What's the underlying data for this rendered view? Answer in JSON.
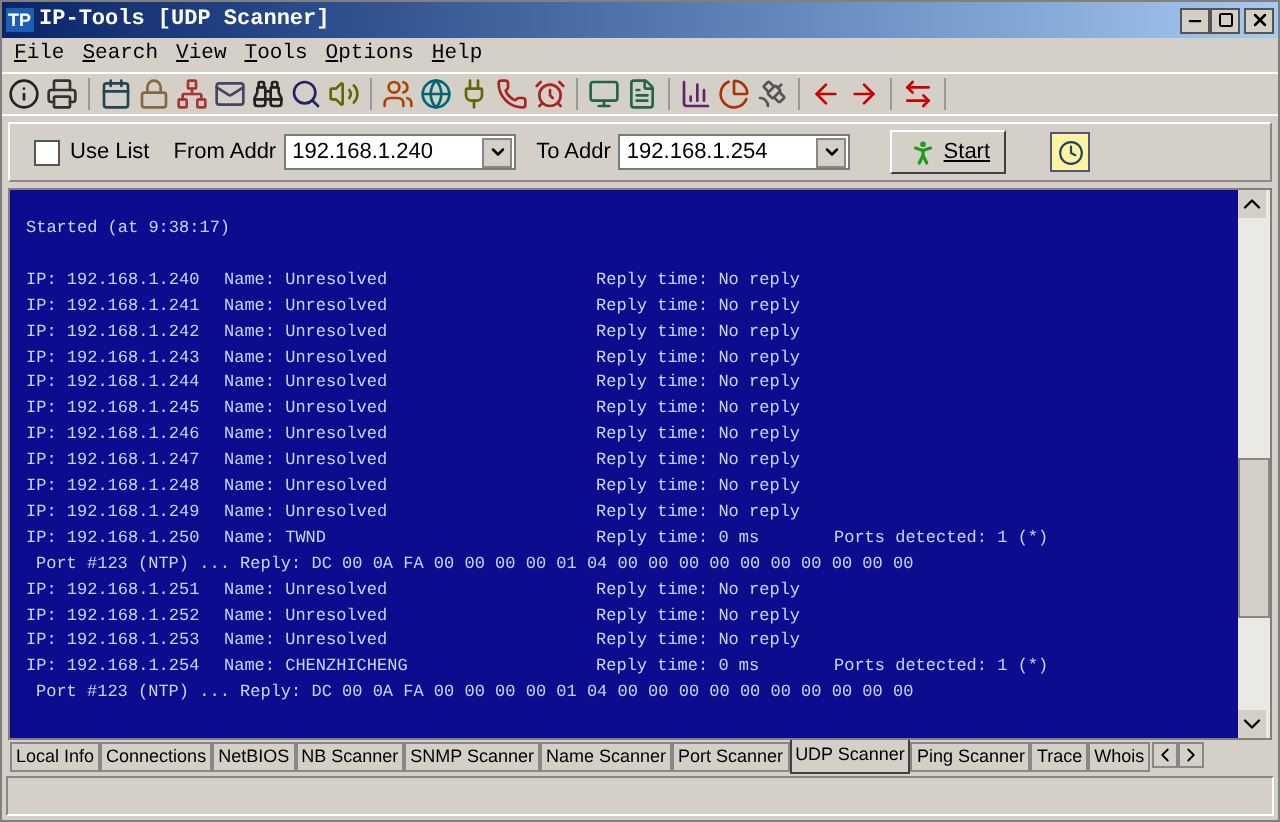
{
  "window": {
    "title": "IP-Tools [UDP Scanner]",
    "app_icon": "TP"
  },
  "menu": [
    "File",
    "Search",
    "View",
    "Tools",
    "Options",
    "Help"
  ],
  "options_bar": {
    "use_list": {
      "label": "Use List",
      "checked": false
    },
    "from": {
      "label": "From Addr",
      "value": "192.168.1.240"
    },
    "to": {
      "label": "To Addr",
      "value": "192.168.1.254"
    },
    "start_button": "Start"
  },
  "console": {
    "started": "Started (at 9:38:17)",
    "lines": [
      {
        "kind": "host",
        "ip": "IP: 192.168.1.240",
        "name": "Name: Unresolved",
        "reply": "Reply time: No reply"
      },
      {
        "kind": "host",
        "ip": "IP: 192.168.1.241",
        "name": "Name: Unresolved",
        "reply": "Reply time: No reply"
      },
      {
        "kind": "host",
        "ip": "IP: 192.168.1.242",
        "name": "Name: Unresolved",
        "reply": "Reply time: No reply"
      },
      {
        "kind": "host",
        "ip": "IP: 192.168.1.243",
        "name": "Name: Unresolved",
        "reply": "Reply time: No reply"
      },
      {
        "kind": "host",
        "ip": "IP: 192.168.1.244",
        "name": "Name: Unresolved",
        "reply": "Reply time: No reply"
      },
      {
        "kind": "host",
        "ip": "IP: 192.168.1.245",
        "name": "Name: Unresolved",
        "reply": "Reply time: No reply"
      },
      {
        "kind": "host",
        "ip": "IP: 192.168.1.246",
        "name": "Name: Unresolved",
        "reply": "Reply time: No reply"
      },
      {
        "kind": "host",
        "ip": "IP: 192.168.1.247",
        "name": "Name: Unresolved",
        "reply": "Reply time: No reply"
      },
      {
        "kind": "host",
        "ip": "IP: 192.168.1.248",
        "name": "Name: Unresolved",
        "reply": "Reply time: No reply"
      },
      {
        "kind": "host",
        "ip": "IP: 192.168.1.249",
        "name": "Name: Unresolved",
        "reply": "Reply time: No reply"
      },
      {
        "kind": "host",
        "ip": "IP: 192.168.1.250",
        "name": "Name: TWND",
        "reply": "Reply time: 0 ms",
        "ports": "Ports detected: 1 (*)"
      },
      {
        "kind": "port",
        "text": "Port #123 (NTP) ... Reply: DC 00 0A FA 00 00 00 00 01 04 00 00 00 00 00 00 00 00 00 00"
      },
      {
        "kind": "host",
        "ip": "IP: 192.168.1.251",
        "name": "Name: Unresolved",
        "reply": "Reply time: No reply"
      },
      {
        "kind": "host",
        "ip": "IP: 192.168.1.252",
        "name": "Name: Unresolved",
        "reply": "Reply time: No reply"
      },
      {
        "kind": "host",
        "ip": "IP: 192.168.1.253",
        "name": "Name: Unresolved",
        "reply": "Reply time: No reply"
      },
      {
        "kind": "host",
        "ip": "IP: 192.168.1.254",
        "name": "Name: CHENZHICHENG",
        "reply": "Reply time: 0 ms",
        "ports": "Ports detected: 1 (*)"
      },
      {
        "kind": "port",
        "text": "Port #123 (NTP) ... Reply: DC 00 0A FA 00 00 00 00 01 04 00 00 00 00 00 00 00 00 00 00"
      }
    ]
  },
  "tabs": [
    {
      "label": "Local Info",
      "selected": false
    },
    {
      "label": "Connections",
      "selected": false
    },
    {
      "label": "NetBIOS",
      "selected": false
    },
    {
      "label": "NB Scanner",
      "selected": false
    },
    {
      "label": "SNMP Scanner",
      "selected": false
    },
    {
      "label": "Name Scanner",
      "selected": false
    },
    {
      "label": "Port Scanner",
      "selected": false
    },
    {
      "label": "UDP Scanner",
      "selected": true
    },
    {
      "label": "Ping Scanner",
      "selected": false
    },
    {
      "label": "Trace",
      "selected": false
    },
    {
      "label": "Whois",
      "selected": false
    }
  ]
}
